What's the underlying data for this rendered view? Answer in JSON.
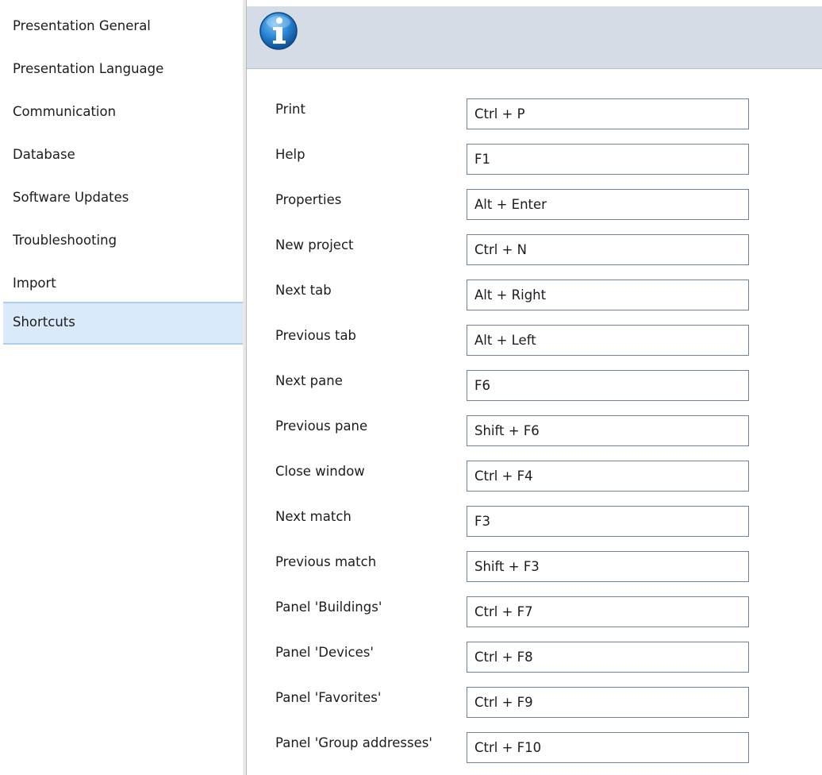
{
  "sidebar": {
    "items": [
      {
        "label": "Presentation General"
      },
      {
        "label": "Presentation Language"
      },
      {
        "label": "Communication"
      },
      {
        "label": "Database"
      },
      {
        "label": "Software Updates"
      },
      {
        "label": "Troubleshooting"
      },
      {
        "label": "Import"
      },
      {
        "label": "Shortcuts",
        "selected": true
      }
    ]
  },
  "header": {
    "icon": "info-icon",
    "icon_colors": {
      "outer": "#1a6db5",
      "inner": "#4aa3e8",
      "glyph": "#ffffff"
    }
  },
  "shortcuts": [
    {
      "label": "Print",
      "value": "Ctrl + P"
    },
    {
      "label": "Help",
      "value": "F1"
    },
    {
      "label": "Properties",
      "value": "Alt + Enter"
    },
    {
      "label": "New project",
      "value": "Ctrl + N"
    },
    {
      "label": "Next tab",
      "value": "Alt + Right"
    },
    {
      "label": "Previous tab",
      "value": "Alt + Left"
    },
    {
      "label": "Next pane",
      "value": "F6"
    },
    {
      "label": "Previous pane",
      "value": "Shift + F6"
    },
    {
      "label": "Close window",
      "value": "Ctrl + F4"
    },
    {
      "label": "Next match",
      "value": "F3"
    },
    {
      "label": "Previous match",
      "value": "Shift + F3"
    },
    {
      "label": "Panel 'Buildings'",
      "value": "Ctrl + F7"
    },
    {
      "label": "Panel 'Devices'",
      "value": "Ctrl + F8"
    },
    {
      "label": "Panel 'Favorites'",
      "value": "Ctrl + F9"
    },
    {
      "label": "Panel 'Group addresses'",
      "value": "Ctrl + F10"
    }
  ],
  "colors": {
    "selected_bg": "#daeafb",
    "selected_border": "#aed0ef",
    "header_bg": "#d5dce6",
    "input_border": "#6f8194"
  }
}
